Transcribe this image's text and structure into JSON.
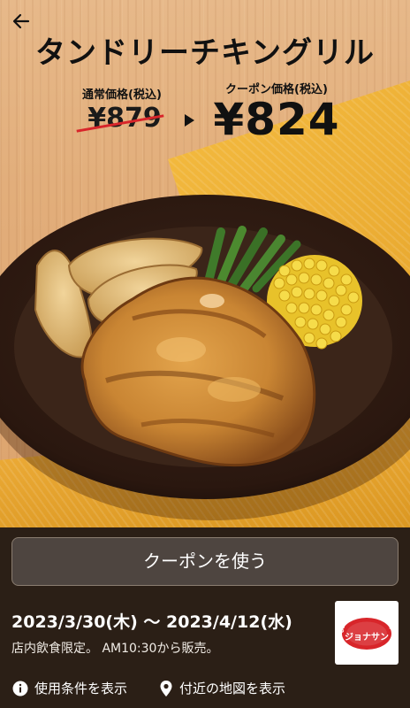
{
  "header": {
    "back_icon": "arrow-left-icon",
    "title": "タンドリーチキングリル"
  },
  "pricing": {
    "regular_label": "通常価格(税込)",
    "regular_price": "¥879",
    "coupon_label": "クーポン価格(税込)",
    "coupon_price": "¥824",
    "arrow_icon": "triangle-right-icon"
  },
  "actions": {
    "use_coupon_label": "クーポンを使う"
  },
  "validity": {
    "period": "2023/3/30(木) 〜 2023/4/12(水)",
    "note": "店内飲食限定。 AM10:30から販売。"
  },
  "brand": {
    "logo_text": "ジョナサン",
    "logo_tagline": "COFFEE & RESTAURANT",
    "logo_color": "#d8252a"
  },
  "links": {
    "terms_label": "使用条件を表示",
    "terms_icon": "info-icon",
    "map_label": "付近の地図を表示",
    "map_icon": "map-pin-icon"
  },
  "colors": {
    "panel_bg": "#2b1f16",
    "button_bg": "#4e4540",
    "strike": "#d8252a"
  }
}
